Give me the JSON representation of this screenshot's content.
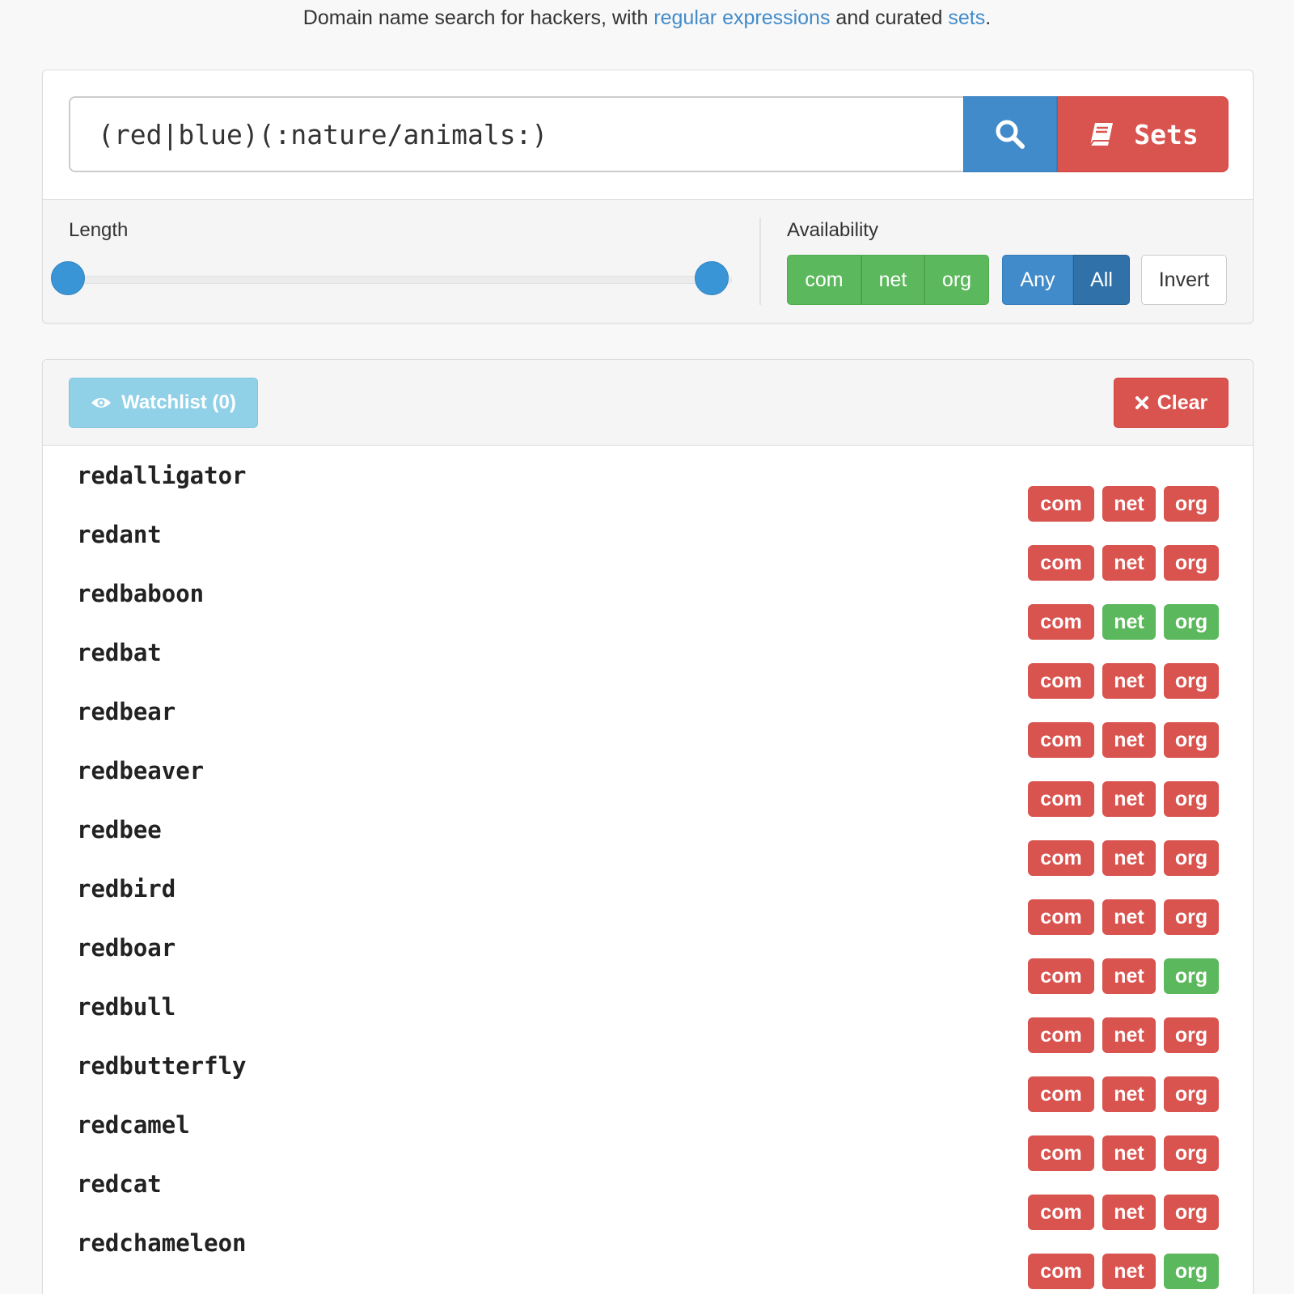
{
  "tagline": {
    "prefix": "Domain name search for hackers, with ",
    "link1": "regular expressions",
    "middle": " and curated ",
    "link2": "sets",
    "suffix": "."
  },
  "search": {
    "query": "(red|blue)(:nature/animals:)",
    "search_icon": "search-icon",
    "sets_label": "Sets",
    "sets_icon": "book-icon"
  },
  "filters": {
    "length_label": "Length",
    "availability_label": "Availability",
    "tlds": [
      "com",
      "net",
      "org"
    ],
    "mode": [
      "Any",
      "All"
    ],
    "mode_selected": "All",
    "invert_label": "Invert"
  },
  "results_header": {
    "watchlist_label": "Watchlist (0)",
    "watchlist_icon": "eye-icon",
    "clear_label": "Clear",
    "clear_icon": "close-icon"
  },
  "colors": {
    "available": "#5cb85c",
    "taken": "#d9534f",
    "primary": "#428bca"
  },
  "results": [
    {
      "name": "redalligator",
      "com": "taken",
      "net": "taken",
      "org": "taken"
    },
    {
      "name": "redant",
      "com": "taken",
      "net": "taken",
      "org": "taken"
    },
    {
      "name": "redbaboon",
      "com": "taken",
      "net": "free",
      "org": "free"
    },
    {
      "name": "redbat",
      "com": "taken",
      "net": "taken",
      "org": "taken"
    },
    {
      "name": "redbear",
      "com": "taken",
      "net": "taken",
      "org": "taken"
    },
    {
      "name": "redbeaver",
      "com": "taken",
      "net": "taken",
      "org": "taken"
    },
    {
      "name": "redbee",
      "com": "taken",
      "net": "taken",
      "org": "taken"
    },
    {
      "name": "redbird",
      "com": "taken",
      "net": "taken",
      "org": "taken"
    },
    {
      "name": "redboar",
      "com": "taken",
      "net": "taken",
      "org": "free"
    },
    {
      "name": "redbull",
      "com": "taken",
      "net": "taken",
      "org": "taken"
    },
    {
      "name": "redbutterfly",
      "com": "taken",
      "net": "taken",
      "org": "taken"
    },
    {
      "name": "redcamel",
      "com": "taken",
      "net": "taken",
      "org": "taken"
    },
    {
      "name": "redcat",
      "com": "taken",
      "net": "taken",
      "org": "taken"
    },
    {
      "name": "redchameleon",
      "com": "taken",
      "net": "taken",
      "org": "free"
    }
  ]
}
